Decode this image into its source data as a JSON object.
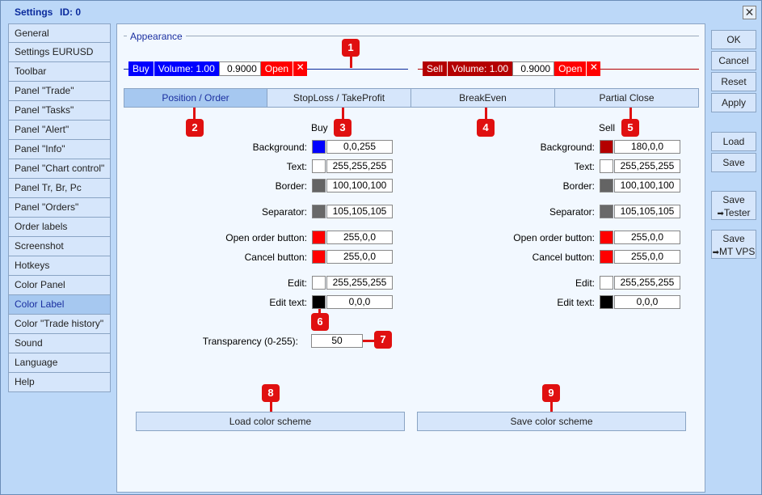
{
  "window": {
    "title": "Settings",
    "id_label": "ID: 0",
    "close_glyph": "✕"
  },
  "sidebar": {
    "items": [
      {
        "label": "General"
      },
      {
        "label": "Settings EURUSD"
      },
      {
        "label": "Toolbar"
      },
      {
        "label": "Panel \"Trade\""
      },
      {
        "label": "Panel \"Tasks\""
      },
      {
        "label": "Panel \"Alert\""
      },
      {
        "label": "Panel \"Info\""
      },
      {
        "label": "Panel \"Chart control\""
      },
      {
        "label": "Panel Tr, Br, Pc"
      },
      {
        "label": "Panel \"Orders\""
      },
      {
        "label": "Order labels"
      },
      {
        "label": "Screenshot"
      },
      {
        "label": "Hotkeys"
      },
      {
        "label": "Color Panel"
      },
      {
        "label": "Color Label"
      },
      {
        "label": "Color \"Trade history\""
      },
      {
        "label": "Sound"
      },
      {
        "label": "Language"
      },
      {
        "label": "Help"
      }
    ],
    "active_index": 14
  },
  "appearance": {
    "label": "Appearance"
  },
  "preview": {
    "buy": {
      "side": "Buy",
      "volume": "Volume: 1.00",
      "price": "0.9000",
      "open": "Open",
      "close_glyph": "✕",
      "color": "#0000ff",
      "button_color": "#ff0000"
    },
    "sell": {
      "side": "Sell",
      "volume": "Volume: 1.00",
      "price": "0.9000",
      "open": "Open",
      "close_glyph": "✕",
      "color": "#b40000",
      "button_color": "#ff0000"
    }
  },
  "tabs": [
    {
      "label": "Position / Order"
    },
    {
      "label": "StopLoss / TakeProfit"
    },
    {
      "label": "BreakEven"
    },
    {
      "label": "Partial Close"
    }
  ],
  "columns": {
    "buy": "Buy",
    "sell": "Sell"
  },
  "rows": [
    {
      "label": "Background:",
      "buy": {
        "value": "0,0,255",
        "color": "#0000ff"
      },
      "sell": {
        "value": "180,0,0",
        "color": "#b40000"
      }
    },
    {
      "label": "Text:",
      "buy": {
        "value": "255,255,255",
        "color": "#ffffff"
      },
      "sell": {
        "value": "255,255,255",
        "color": "#ffffff"
      }
    },
    {
      "label": "Border:",
      "buy": {
        "value": "100,100,100",
        "color": "#646464"
      },
      "sell": {
        "value": "100,100,100",
        "color": "#646464"
      }
    },
    {
      "label": "Separator:",
      "buy": {
        "value": "105,105,105",
        "color": "#696969"
      },
      "sell": {
        "value": "105,105,105",
        "color": "#696969"
      }
    },
    {
      "label": "Open order button:",
      "buy": {
        "value": "255,0,0",
        "color": "#ff0000"
      },
      "sell": {
        "value": "255,0,0",
        "color": "#ff0000"
      }
    },
    {
      "label": "Cancel button:",
      "buy": {
        "value": "255,0,0",
        "color": "#ff0000"
      },
      "sell": {
        "value": "255,0,0",
        "color": "#ff0000"
      }
    },
    {
      "label": "Edit:",
      "buy": {
        "value": "255,255,255",
        "color": "#ffffff"
      },
      "sell": {
        "value": "255,255,255",
        "color": "#ffffff"
      }
    },
    {
      "label": "Edit text:",
      "buy": {
        "value": "0,0,0",
        "color": "#000000"
      },
      "sell": {
        "value": "0,0,0",
        "color": "#000000"
      }
    }
  ],
  "transparency": {
    "label": "Transparency (0-255):",
    "value": "50"
  },
  "buttons": {
    "load_scheme": "Load color scheme",
    "save_scheme": "Save color scheme"
  },
  "right_buttons": {
    "ok": "OK",
    "cancel": "Cancel",
    "reset": "Reset",
    "apply": "Apply",
    "load": "Load",
    "save": "Save",
    "save_tester_top": "Save",
    "save_tester_bottom": "Tester",
    "save_vps_top": "Save",
    "save_vps_bottom": "MT VPS",
    "arrow_glyph": "➡"
  },
  "callouts": [
    "1",
    "2",
    "3",
    "4",
    "5",
    "6",
    "7",
    "8",
    "9"
  ],
  "accent_color": "#e01010"
}
